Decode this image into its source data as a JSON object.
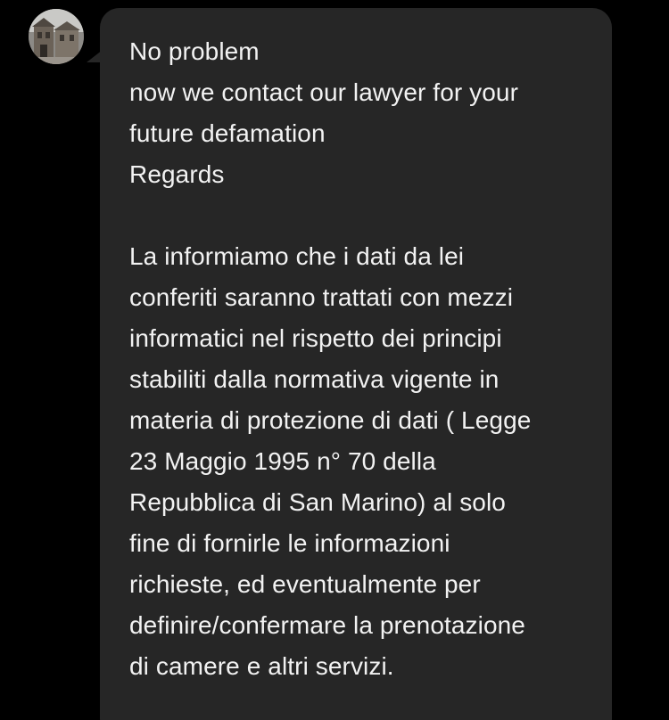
{
  "message": {
    "sender_avatar_icon": "avatar-photo-building",
    "bubble_color": "#262626",
    "text_color": "#f2f2f2",
    "background_color": "#000000",
    "lines": [
      "No problem",
      "now we contact our lawyer for your",
      "future defamation",
      "Regards",
      "",
      "La informiamo che i dati da lei",
      "conferiti saranno trattati con mezzi",
      "informatici nel rispetto dei principi",
      "stabiliti dalla normativa vigente in",
      "materia di protezione di dati ( Legge",
      "23 Maggio 1995 n° 70 della",
      "Repubblica di San Marino) al solo",
      "fine di fornirle le informazioni",
      "richieste, ed eventualmente per",
      "definire/confermare la prenotazione",
      "di camere e altri servizi."
    ]
  }
}
